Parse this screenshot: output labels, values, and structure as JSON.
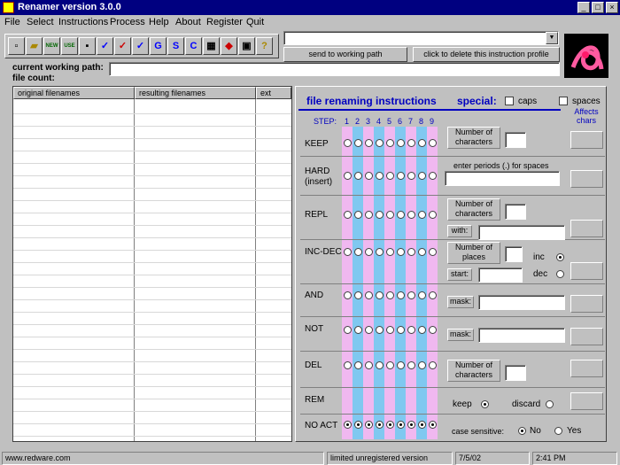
{
  "window": {
    "title": "Renamer version 3.0.0"
  },
  "menu": [
    "File",
    "Select",
    "Instructions",
    "Process",
    "Help",
    "About",
    "Register",
    "Quit"
  ],
  "toolbar": {
    "send_label": "send to working path",
    "delete_label": "click to delete this instruction profile"
  },
  "paths": {
    "current_label": "current working path:",
    "count_label": "file count:"
  },
  "list": {
    "col1": "original filenames",
    "col2": "resulting filenames",
    "col3": "ext"
  },
  "panel": {
    "title": "file renaming instructions",
    "special": "special:",
    "caps": "caps",
    "spaces": "spaces",
    "affects": "Affects chars",
    "step_label": "STEP:",
    "steps": [
      "1",
      "2",
      "3",
      "4",
      "5",
      "6",
      "7",
      "8",
      "9"
    ],
    "rows": {
      "keep": "KEEP",
      "hard1": "HARD",
      "hard2": "(insert)",
      "repl": "REPL",
      "incdec": "INC-DEC",
      "and": "AND",
      "not": "NOT",
      "del": "DEL",
      "rem": "REM",
      "noact": "NO ACT"
    },
    "num_chars1": "Number of",
    "num_chars2": "characters",
    "periods_note": "enter periods (.) for spaces",
    "with": "with:",
    "num_places1": "Number of",
    "num_places2": "places",
    "start": "start:",
    "inc": "inc",
    "dec": "dec",
    "mask": "mask:",
    "keep_opt": "keep",
    "discard_opt": "discard",
    "case_label": "case sensitive:",
    "no_opt": "No",
    "yes_opt": "Yes"
  },
  "status": {
    "site": "www.redware.com",
    "license": "limited unregistered version",
    "date": "7/5/02",
    "time": "2:41 PM"
  }
}
